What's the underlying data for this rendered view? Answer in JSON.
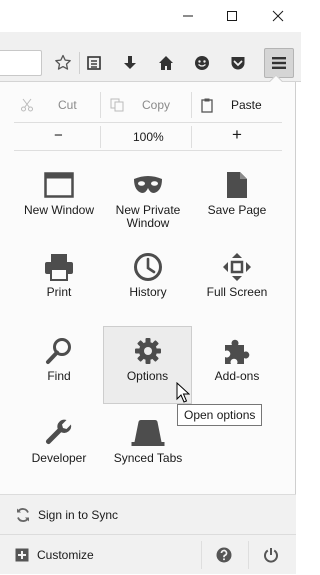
{
  "window": {
    "minimize_icon": "minimize-icon",
    "maximize_icon": "maximize-icon",
    "close_icon": "close-icon"
  },
  "toolbar": {
    "icons": [
      "star-icon",
      "reading-list-icon",
      "download-icon",
      "home-icon",
      "hello-icon",
      "pocket-icon",
      "hamburger-menu-icon"
    ]
  },
  "edit": {
    "cut": "Cut",
    "copy": "Copy",
    "paste": "Paste"
  },
  "zoom": {
    "minus": "−",
    "value": "100%",
    "plus": "+"
  },
  "tiles": [
    {
      "label": "New Window",
      "icon": "new-window-icon"
    },
    {
      "label": "New Private Window",
      "icon": "private-mask-icon"
    },
    {
      "label": "Save Page",
      "icon": "save-page-icon"
    },
    {
      "label": "Print",
      "icon": "printer-icon"
    },
    {
      "label": "History",
      "icon": "clock-icon"
    },
    {
      "label": "Full Screen",
      "icon": "fullscreen-icon"
    },
    {
      "label": "Find",
      "icon": "magnifier-icon"
    },
    {
      "label": "Options",
      "icon": "gear-icon"
    },
    {
      "label": "Add-ons",
      "icon": "puzzle-icon"
    },
    {
      "label": "Developer",
      "icon": "wrench-icon"
    },
    {
      "label": "Synced Tabs",
      "icon": "synced-tabs-icon"
    }
  ],
  "tooltip": "Open options",
  "footer": {
    "sync": "Sign in to Sync",
    "customize": "Customize"
  },
  "colors": {
    "icon": "#4d4d4d",
    "hover": "#ececec",
    "panel": "#fbfbfb"
  }
}
